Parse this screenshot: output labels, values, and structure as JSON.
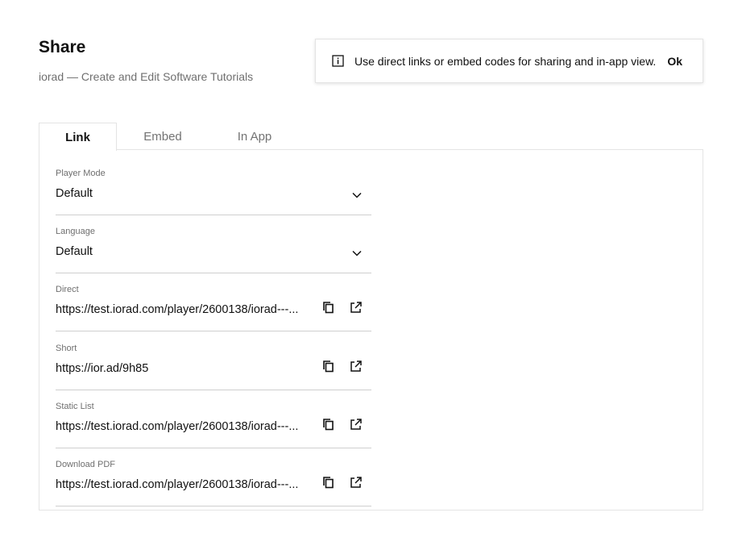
{
  "header": {
    "title": "Share",
    "subtitle": "iorad — Create and Edit Software Tutorials"
  },
  "notice": {
    "icon": "info-icon",
    "text": "Use direct links or embed codes for sharing and in-app view.",
    "ok_label": "Ok"
  },
  "tabs": [
    {
      "label": "Link",
      "active": true
    },
    {
      "label": "Embed",
      "active": false
    },
    {
      "label": "In App",
      "active": false
    }
  ],
  "fields": {
    "player_mode": {
      "label": "Player Mode",
      "value": "Default",
      "icon": "chevron-down-icon"
    },
    "language": {
      "label": "Language",
      "value": "Default",
      "icon": "chevron-down-icon"
    },
    "direct": {
      "label": "Direct",
      "value": "https://test.iorad.com/player/2600138/iorad---..."
    },
    "short": {
      "label": "Short",
      "value": "https://ior.ad/9h85"
    },
    "static_list": {
      "label": "Static List",
      "value": "https://test.iorad.com/player/2600138/iorad---..."
    },
    "download_pdf": {
      "label": "Download PDF",
      "value": "https://test.iorad.com/player/2600138/iorad---..."
    }
  },
  "icons": {
    "copy": "copy-icon",
    "open": "external-link-icon"
  },
  "colors": {
    "text": "#111111",
    "muted": "#6f6f6f",
    "border": "#e4e4e4",
    "underline": "#cfcfcf"
  }
}
